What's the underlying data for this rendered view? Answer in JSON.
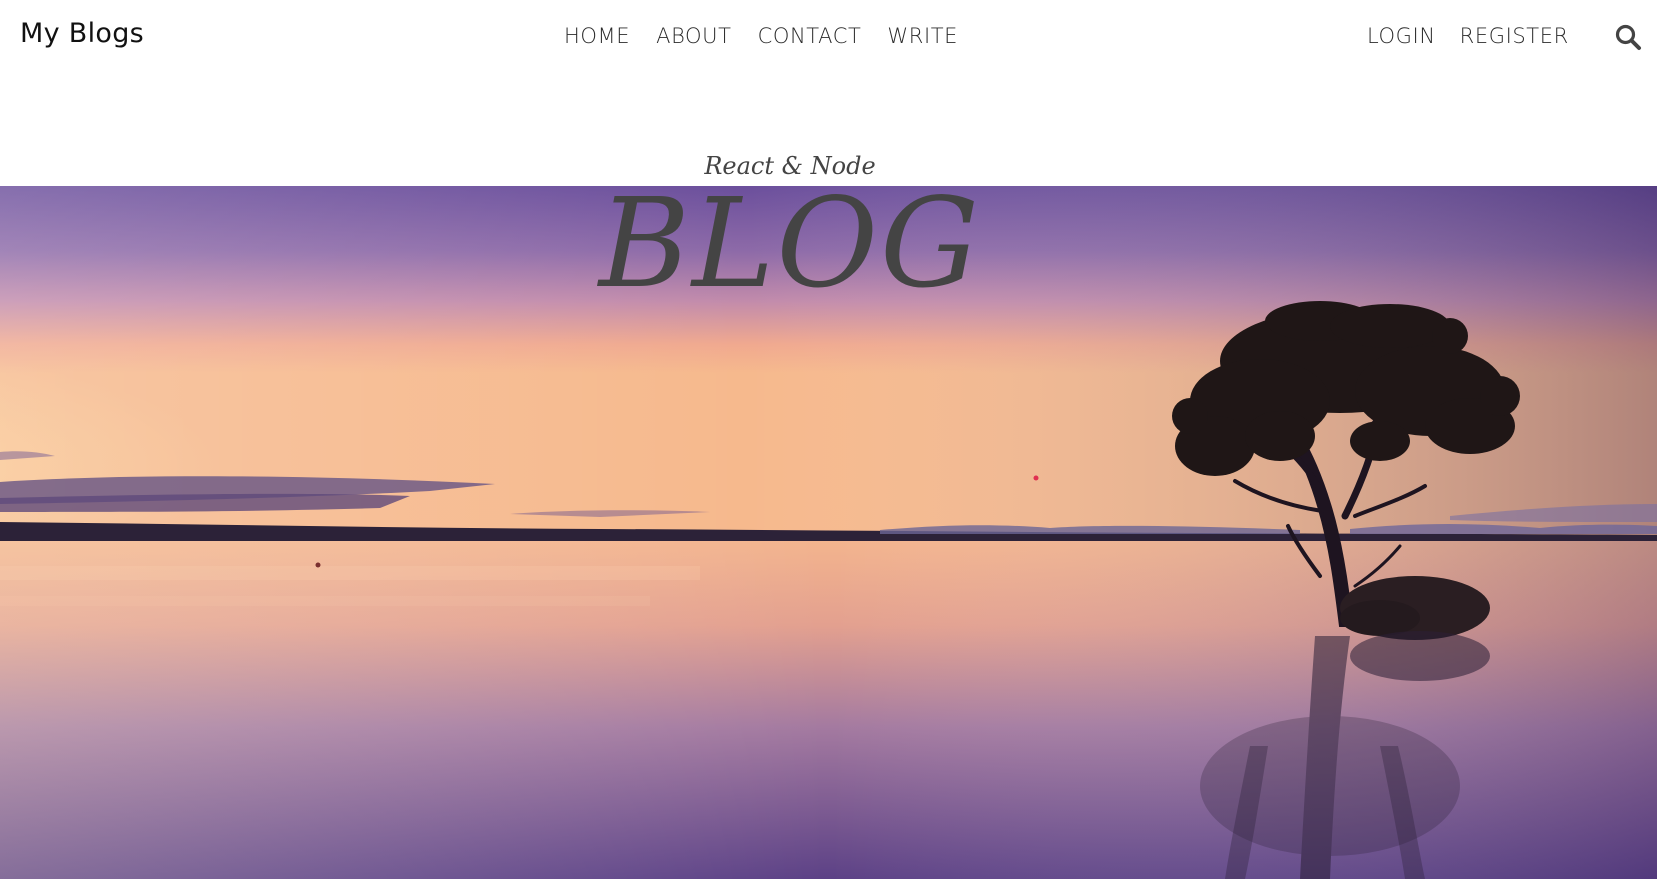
{
  "header": {
    "brand": "My Blogs",
    "nav_center": [
      "HOME",
      "ABOUT",
      "CONTACT",
      "WRITE"
    ],
    "nav_right": [
      "LOGIN",
      "REGISTER"
    ],
    "search_icon": "search-icon"
  },
  "hero": {
    "subtitle": "React & Node",
    "title": "BLOG",
    "image": "sunset-lake-tree"
  },
  "colors": {
    "text": "#444444",
    "nav_text": "#2b2b2b",
    "sky_top": "#5a3f8a",
    "sky_horizon": "#f7b98c",
    "water": "#7a5a9a"
  }
}
